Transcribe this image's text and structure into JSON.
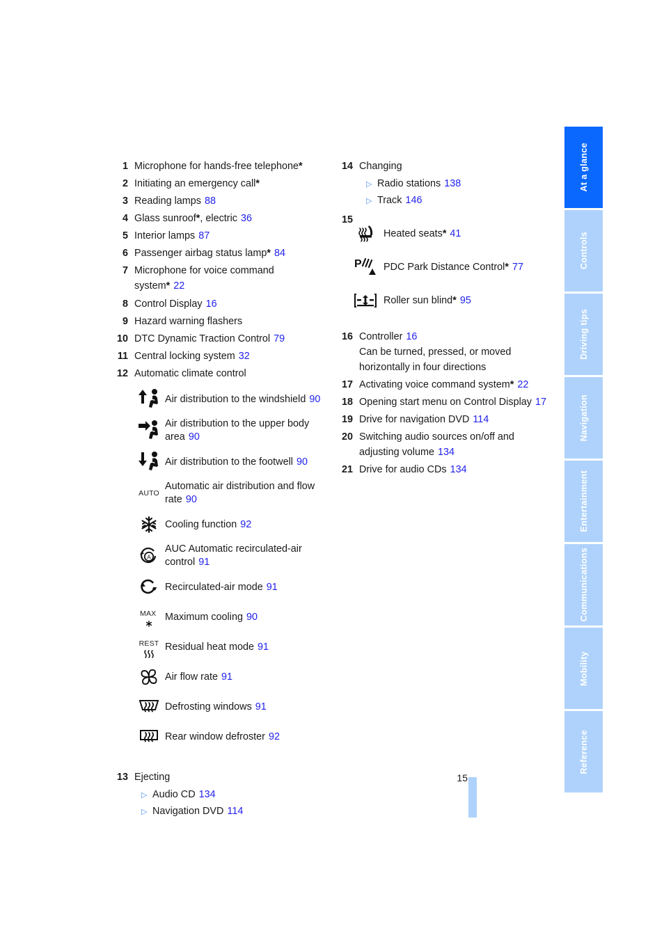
{
  "page": {
    "number": "15"
  },
  "tabs": [
    {
      "label": "At a glance",
      "active": true
    },
    {
      "label": "Controls",
      "active": false
    },
    {
      "label": "Driving tips",
      "active": false
    },
    {
      "label": "Navigation",
      "active": false
    },
    {
      "label": "Entertainment",
      "active": false
    },
    {
      "label": "Communications",
      "active": false
    },
    {
      "label": "Mobility",
      "active": false
    },
    {
      "label": "Reference",
      "active": false
    }
  ],
  "colors": {
    "reference_blue": "#2222ee",
    "tab_active": "#0a68ff",
    "tab_inactive": "#aed2fb",
    "bullet_blue": "#4d8ff0"
  },
  "left_column": {
    "items": [
      {
        "num": "1",
        "text": "Microphone for hands-free telephone",
        "star": "*",
        "ref": ""
      },
      {
        "num": "2",
        "text": "Initiating an emergency call",
        "star": "*",
        "ref": ""
      },
      {
        "num": "3",
        "text": "Reading lamps",
        "star": "",
        "ref": "88"
      },
      {
        "num": "4",
        "text": "Glass sunroof",
        "star": "*",
        "text_after": ", electric",
        "ref": "36"
      },
      {
        "num": "5",
        "text": "Interior lamps",
        "star": "",
        "ref": "87"
      },
      {
        "num": "6",
        "text": "Passenger airbag status lamp",
        "star": "*",
        "ref": "84"
      },
      {
        "num": "7",
        "text": "Microphone for voice command system",
        "star": "*",
        "ref": "22"
      },
      {
        "num": "8",
        "text": "Control Display",
        "star": "",
        "ref": "16"
      },
      {
        "num": "9",
        "text": "Hazard warning flashers",
        "star": "",
        "ref": ""
      },
      {
        "num": "10",
        "text": "DTC Dynamic Traction Control",
        "star": "",
        "ref": "79"
      },
      {
        "num": "11",
        "text": "Central locking system",
        "star": "",
        "ref": "32"
      },
      {
        "num": "12",
        "text": "Automatic climate control",
        "star": "",
        "ref": ""
      }
    ],
    "climate_icons": [
      {
        "icon": "air-distribution-windshield-icon",
        "label": "Air distribution to the windshield",
        "ref": "90"
      },
      {
        "icon": "air-distribution-upper-body-icon",
        "label": "Air distribution to the upper body area",
        "ref": "90"
      },
      {
        "icon": "air-distribution-footwell-icon",
        "label": "Air distribution to the footwell",
        "ref": "90"
      },
      {
        "icon": "auto-icon",
        "label": "Automatic air distribution and flow rate",
        "ref": "90",
        "icon_text": "AUTO"
      },
      {
        "icon": "snowflake-cooling-icon",
        "label": "Cooling function",
        "ref": "92"
      },
      {
        "icon": "auc-recirculated-air-icon",
        "label": "AUC Automatic recirculated-air control",
        "ref": "91"
      },
      {
        "icon": "recirculated-air-mode-icon",
        "label": "Recirculated-air mode",
        "ref": "91"
      },
      {
        "icon": "max-cooling-icon",
        "label": "Maximum cooling",
        "ref": "90",
        "icon_text": "MAX"
      },
      {
        "icon": "residual-heat-icon",
        "label": "Residual heat mode",
        "ref": "91",
        "icon_text": "REST"
      },
      {
        "icon": "fan-air-flow-rate-icon",
        "label": "Air flow rate",
        "ref": "91"
      },
      {
        "icon": "defrosting-windows-icon",
        "label": "Defrosting windows",
        "ref": "91"
      },
      {
        "icon": "rear-window-defroster-icon",
        "label": "Rear window defroster",
        "ref": "92"
      }
    ],
    "ejecting": {
      "num": "13",
      "title": "Ejecting",
      "subitems": [
        {
          "label": "Audio CD",
          "ref": "134"
        },
        {
          "label": "Navigation DVD",
          "ref": "114"
        }
      ]
    }
  },
  "right_column": {
    "changing": {
      "num": "14",
      "title": "Changing",
      "subitems": [
        {
          "label": "Radio stations",
          "ref": "138"
        },
        {
          "label": "Track",
          "ref": "146"
        }
      ]
    },
    "group15": {
      "num": "15",
      "icons": [
        {
          "icon": "heated-seats-icon",
          "label": "Heated seats",
          "star": "*",
          "ref": "41"
        },
        {
          "icon": "pdc-park-distance-icon",
          "label": "PDC Park Distance Control",
          "star": "*",
          "ref": "77"
        },
        {
          "icon": "roller-sun-blind-icon",
          "label": "Roller sun blind",
          "star": "*",
          "ref": "95"
        }
      ]
    },
    "items": [
      {
        "num": "16",
        "text": "Controller",
        "star": "",
        "ref": "16",
        "sub_text": "Can be turned, pressed, or moved horizontally in four directions"
      },
      {
        "num": "17",
        "text": "Activating voice command system",
        "star": "*",
        "ref": "22"
      },
      {
        "num": "18",
        "text": "Opening start menu on Control Display",
        "star": "",
        "ref": "17"
      },
      {
        "num": "19",
        "text": "Drive for navigation DVD",
        "star": "",
        "ref": "114"
      },
      {
        "num": "20",
        "text": "Switching audio sources on/off and adjusting volume",
        "star": "",
        "ref": "134"
      },
      {
        "num": "21",
        "text": "Drive for audio CDs",
        "star": "",
        "ref": "134"
      }
    ]
  }
}
